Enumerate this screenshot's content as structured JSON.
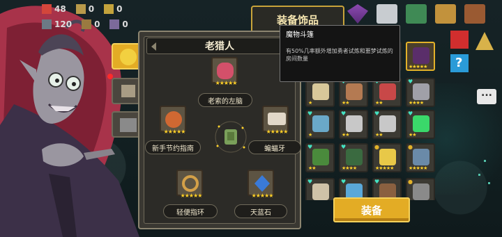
{
  "header": {
    "equip_tab_title": "装备饰品"
  },
  "resources": [
    {
      "icon": "gem-icon",
      "value": "48"
    },
    {
      "icon": "material-icon",
      "value": "0"
    },
    {
      "icon": "part-icon",
      "value": "0"
    },
    {
      "icon": "coin-icon",
      "value": "120"
    },
    {
      "icon": "seed-icon",
      "value": "0"
    },
    {
      "icon": "ticket-icon",
      "value": "0"
    }
  ],
  "panel": {
    "title": "老猎人",
    "slots": [
      {
        "name": "老索的左脑",
        "stars": "★★★★★"
      },
      {
        "name": "新手节约指南",
        "stars": "★★★★★"
      },
      {
        "name": "蝙蝠牙",
        "stars": "★★★★★"
      },
      {
        "name": "轻便指环",
        "stars": "★★★★★"
      },
      {
        "name": "天蓝石",
        "stars": "★★★★★"
      }
    ]
  },
  "tooltip": {
    "title": "魔物斗篷",
    "description": "有50%几率额外增加勇者试炼和噩梦试炼的房间数量"
  },
  "inventory": {
    "rows": [
      [
        "★★★★★",
        "★★★★★",
        "★★★★★",
        "★★★★★"
      ],
      [
        "★",
        "★★",
        "★★",
        "★★★★"
      ],
      [
        "★",
        "★★",
        "★★",
        "★★"
      ],
      [
        "★★",
        "★★★★",
        "★★★★★",
        "★★★★★"
      ],
      [
        "",
        "",
        "",
        ""
      ]
    ]
  },
  "equip_button": "装备",
  "colors": {
    "accent": "#e3ac25",
    "panel": "#3a3832",
    "star": "#ffd22a",
    "heart": "#43e4c4"
  }
}
